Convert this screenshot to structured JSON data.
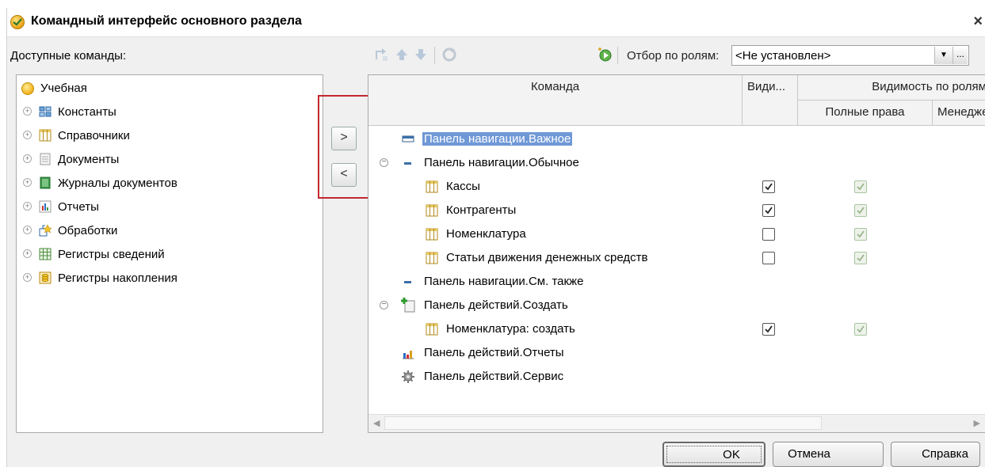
{
  "window": {
    "title": "Командный интерфейс основного раздела",
    "close": "×"
  },
  "left": {
    "label": "Доступные команды:",
    "items": [
      {
        "label": "Учебная",
        "icon": "subsystem-icon",
        "expander": ""
      },
      {
        "label": "Константы",
        "icon": "constants-icon",
        "expander": "+"
      },
      {
        "label": "Справочники",
        "icon": "catalog-icon",
        "expander": "+"
      },
      {
        "label": "Документы",
        "icon": "document-icon",
        "expander": "+"
      },
      {
        "label": "Журналы документов",
        "icon": "journal-icon",
        "expander": "+"
      },
      {
        "label": "Отчеты",
        "icon": "report-icon",
        "expander": "+"
      },
      {
        "label": "Обработки",
        "icon": "processing-icon",
        "expander": "+"
      },
      {
        "label": "Регистры сведений",
        "icon": "info-register-icon",
        "expander": "+"
      },
      {
        "label": "Регистры накопления",
        "icon": "accumulation-register-icon",
        "expander": "+"
      }
    ]
  },
  "move": {
    "add": ">",
    "remove": "<"
  },
  "toolbar": {
    "role_filter_label": "Отбор по ролям:",
    "role_filter_value": "<Не установлен>",
    "dots": "..."
  },
  "grid": {
    "headers": {
      "command": "Команда",
      "visible": "Види...",
      "visibility_by_roles": "Видимость по ролям",
      "role_full": "Полные права",
      "role_manager": "Менеджер"
    },
    "rows": [
      {
        "label": "Панель навигации.Важное",
        "selected": true,
        "visible": null,
        "full_rights": null
      },
      {
        "label": "Панель навигации.Обычное",
        "expander": "−",
        "visible": null,
        "full_rights": null
      },
      {
        "label": "Кассы",
        "visible": true,
        "full_rights": true
      },
      {
        "label": "Контрагенты",
        "visible": true,
        "full_rights": true
      },
      {
        "label": "Номенклатура",
        "visible": false,
        "full_rights": true
      },
      {
        "label": "Статьи движения денежных средств",
        "visible": false,
        "full_rights": true
      },
      {
        "label": "Панель навигации.См. также",
        "visible": null,
        "full_rights": null
      },
      {
        "label": "Панель действий.Создать",
        "expander": "−",
        "visible": null,
        "full_rights": null
      },
      {
        "label": "Номенклатура: создать",
        "visible": true,
        "full_rights": true
      },
      {
        "label": "Панель действий.Отчеты",
        "visible": null,
        "full_rights": null
      },
      {
        "label": "Панель действий.Сервис",
        "visible": null,
        "full_rights": null
      }
    ]
  },
  "buttons": {
    "ok": "OK",
    "cancel": "Отмена",
    "help": "Справка"
  },
  "colors": {
    "selection": "#6f98d6",
    "highlight_border": "#c2272d",
    "title_icon": "#e8a317"
  }
}
